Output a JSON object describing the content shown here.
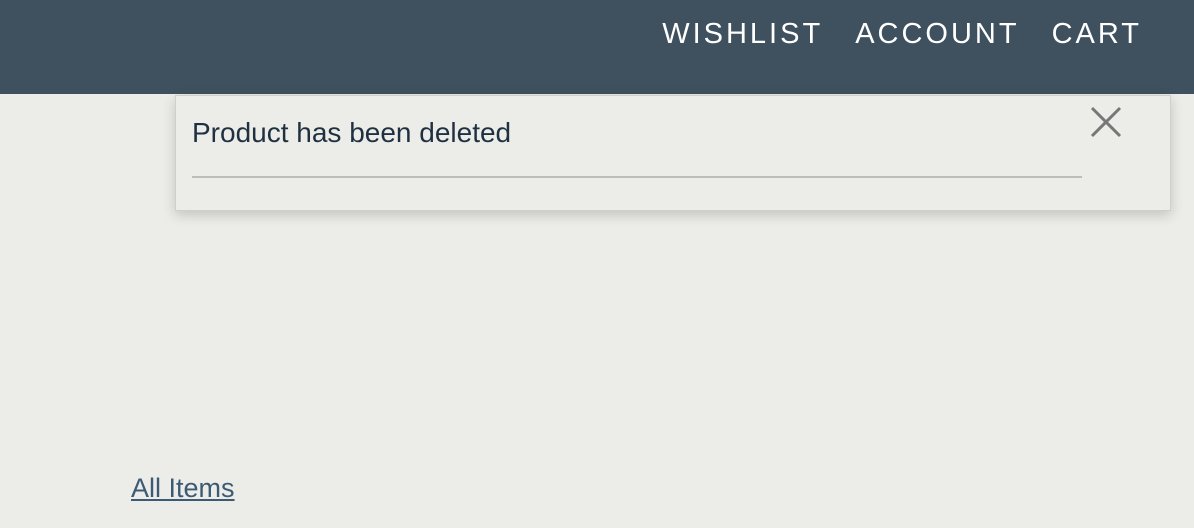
{
  "header": {
    "nav": [
      {
        "label": "WISHLIST"
      },
      {
        "label": "ACCOUNT"
      },
      {
        "label": "CART"
      }
    ]
  },
  "notification": {
    "message": "Product has been deleted",
    "close_icon": "close-icon"
  },
  "links": {
    "all_items": "All Items"
  },
  "colors": {
    "header_bg": "#3f505e",
    "page_bg": "#ecece8",
    "link": "#3d5a74",
    "text": "#1f3140"
  }
}
